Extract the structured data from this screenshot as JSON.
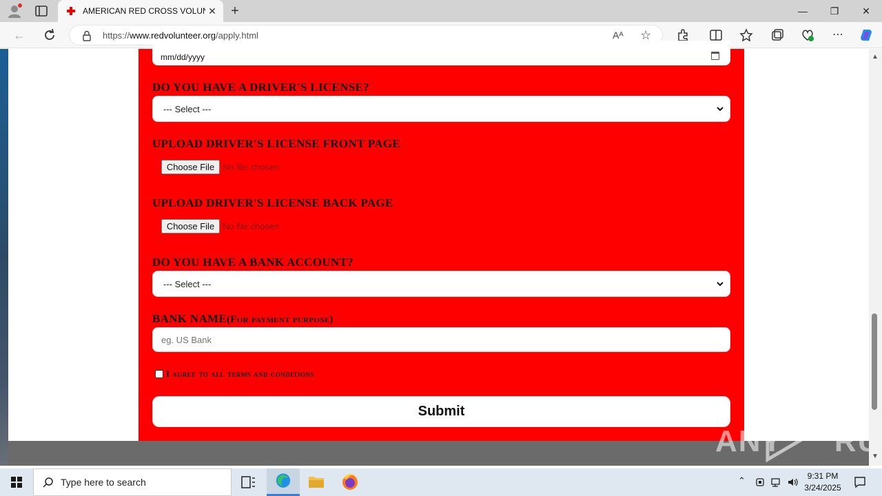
{
  "browser": {
    "tab_title": "AMERICAN RED CROSS VOLUNTEER",
    "tab_close": "✕",
    "new_tab": "+",
    "url_prefix": "https://",
    "url_domain": "www.redvolunteer.org",
    "url_path": "/apply.html",
    "read_aloud": "Aᴬ",
    "window_min": "—",
    "window_max": "❐",
    "window_close": "✕"
  },
  "form": {
    "date_placeholder": "mm/dd/yyyy",
    "license_question": "DO YOU HAVE A DRIVER'S LICENSE?",
    "license_select": "--- Select ---",
    "upload_front_label": "UPLOAD DRIVER'S LICENSE FRONT PAGE",
    "upload_back_label": "UPLOAD DRIVER'S LICENSE BACK PAGE",
    "choose_file": "Choose File",
    "no_file": "No file chosen",
    "bank_question": "DO YOU HAVE A BANK ACCOUNT?",
    "bank_select": "--- Select ---",
    "bank_name_label": "BANK NAME",
    "bank_name_sub": "(For payment purpose)",
    "bank_name_placeholder": "eg. US Bank",
    "terms": "I agree to all terms and conditions",
    "submit": "Submit"
  },
  "watermark": {
    "left": "ANY",
    "right": "RUN"
  },
  "taskbar": {
    "search_placeholder": "Type here to search",
    "time": "9:31 PM",
    "date": "3/24/2025"
  },
  "colors": {
    "form_bg": "#ff0000",
    "titlebar": "#d3d3d3",
    "taskbar": "#dfe8f0"
  }
}
